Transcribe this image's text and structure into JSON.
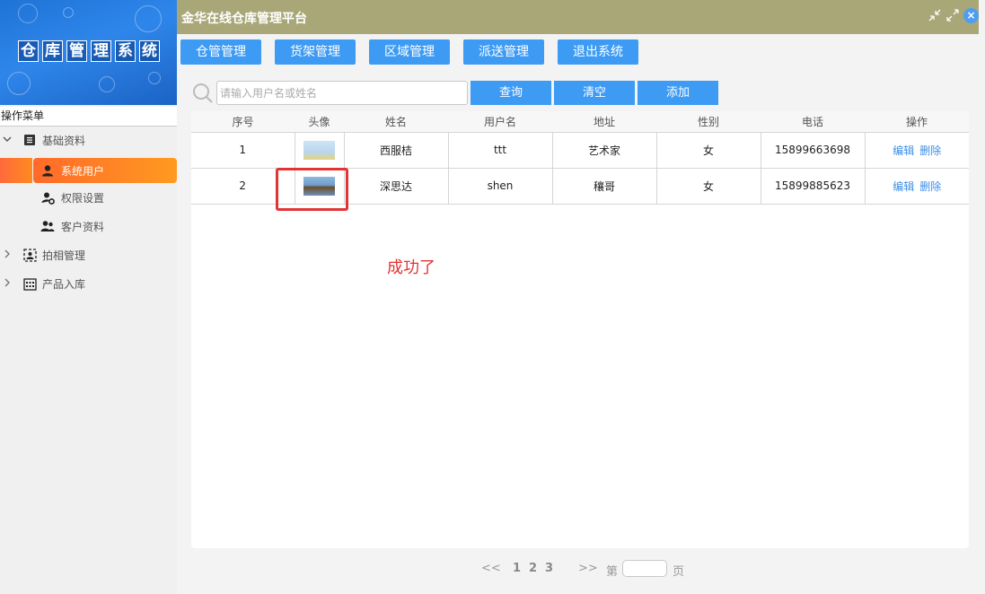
{
  "app": {
    "title": "金华在线仓库管理平台",
    "banner_chars": [
      "仓",
      "库",
      "管",
      "理",
      "系",
      "统"
    ]
  },
  "sidebar": {
    "menu_header": "操作菜单",
    "groups": [
      {
        "label": "基础资料",
        "expanded": true,
        "icon": "document-icon",
        "children": [
          {
            "label": "系统用户",
            "active": true,
            "icon": "user-icon"
          },
          {
            "label": "权限设置",
            "icon": "user-gear-icon"
          },
          {
            "label": "客户资料",
            "icon": "users-icon"
          }
        ]
      },
      {
        "label": "拍相管理",
        "expanded": false,
        "icon": "photo-frame-icon"
      },
      {
        "label": "产品入库",
        "expanded": false,
        "icon": "grid-calendar-icon"
      }
    ]
  },
  "nav": {
    "buttons": [
      "仓管管理",
      "货架管理",
      "区域管理",
      "派送管理",
      "退出系统"
    ]
  },
  "search": {
    "placeholder": "请输入用户名或姓名",
    "value": "",
    "query_label": "查询",
    "clear_label": "清空",
    "add_label": "添加"
  },
  "table": {
    "headers": [
      "序号",
      "头像",
      "姓名",
      "用户名",
      "地址",
      "性别",
      "电话",
      "操作"
    ],
    "rows": [
      {
        "index": "1",
        "name": "西服桔",
        "username": "ttt",
        "address": "艺术家",
        "gender": "女",
        "phone": "15899663698"
      },
      {
        "index": "2",
        "name": "深思达",
        "username": "shen",
        "address": "穰哥",
        "gender": "女",
        "phone": "15899885623"
      }
    ],
    "edit_label": "编辑",
    "delete_label": "删除"
  },
  "annotation": {
    "text": "成功了",
    "color": "#e23434"
  },
  "pagination": {
    "prev": "<<",
    "pages": [
      "1",
      "2",
      "3"
    ],
    "next": ">>",
    "prefix": "第",
    "suffix": "页"
  },
  "colors": {
    "header_bg": "#a9a778",
    "button_blue": "#3d9bf4",
    "active_orange": "#ff8a1f",
    "link_blue": "#3d8ee8"
  }
}
